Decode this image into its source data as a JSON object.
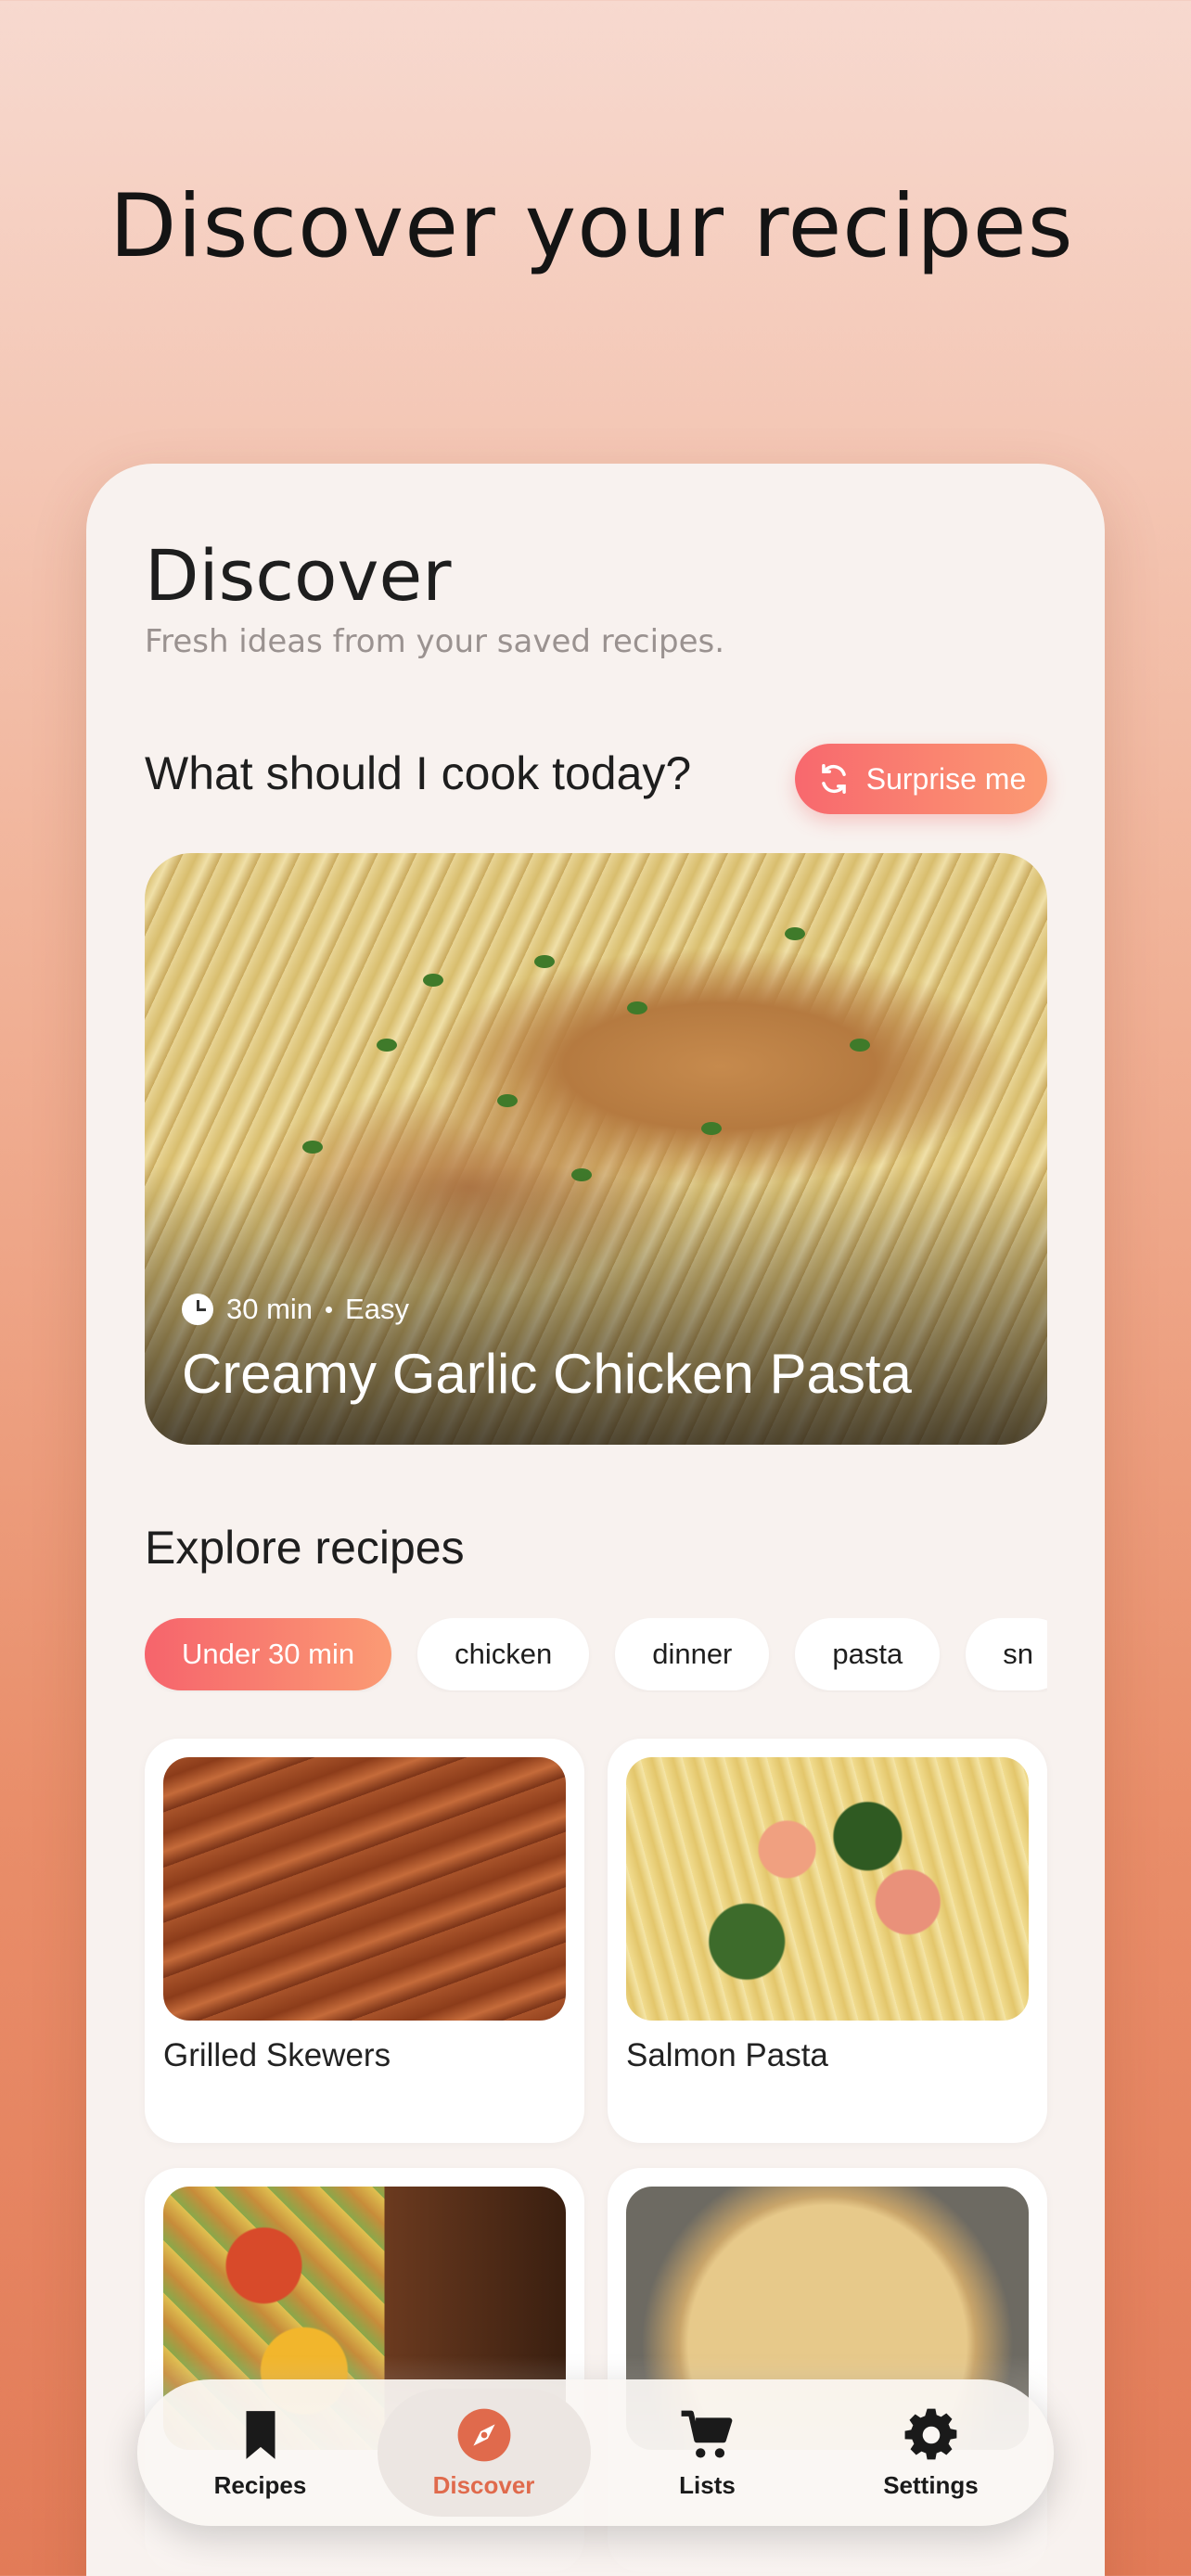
{
  "hero": {
    "title": "Discover your recipes"
  },
  "header": {
    "title": "Discover",
    "subtitle": "Fresh ideas from your saved recipes."
  },
  "today": {
    "question": "What should I cook today?",
    "surprise_label": "Surprise me",
    "featured": {
      "time": "30 min",
      "difficulty": "Easy",
      "title": "Creamy Garlic Chicken Pasta"
    }
  },
  "explore": {
    "title": "Explore recipes",
    "chips": [
      "Under 30 min",
      "chicken",
      "dinner",
      "pasta",
      "sn"
    ],
    "active_chip": "Under 30 min",
    "recipes": [
      {
        "name": "Grilled Skewers"
      },
      {
        "name": "Salmon Pasta"
      }
    ]
  },
  "tabbar": {
    "items": [
      {
        "label": "Recipes",
        "icon": "bookmark-icon"
      },
      {
        "label": "Discover",
        "icon": "compass-icon"
      },
      {
        "label": "Lists",
        "icon": "cart-icon"
      },
      {
        "label": "Settings",
        "icon": "gear-icon"
      }
    ],
    "active": "Discover"
  },
  "colors": {
    "accent_start": "#f6646c",
    "accent_end": "#fb9b74",
    "active_tab": "#e06a4c"
  }
}
